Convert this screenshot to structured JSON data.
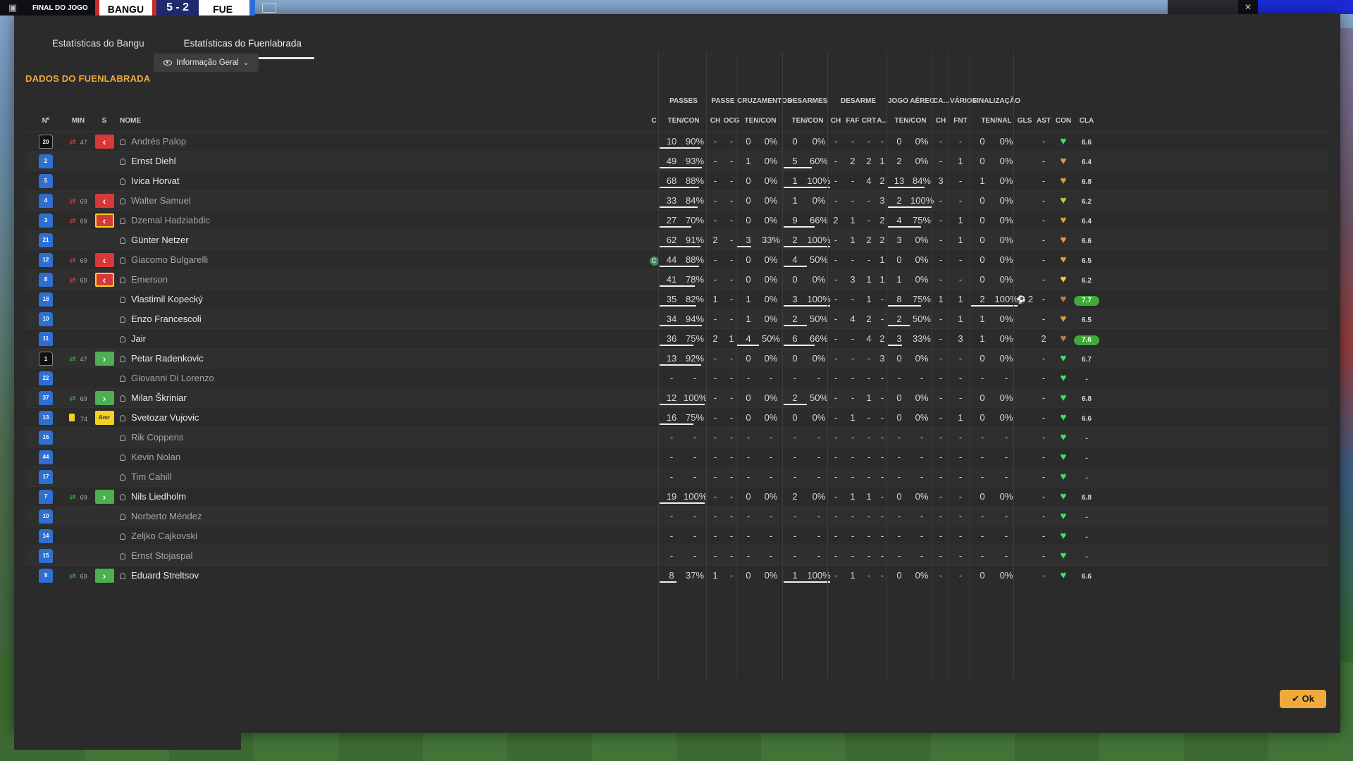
{
  "scorebar": {
    "label": "FINAL DO JOGO",
    "home": "BANGU",
    "score": "5 - 2",
    "away": "FUE"
  },
  "tabs": [
    {
      "label": "Estatísticas do Bangu",
      "active": false
    },
    {
      "label": "Estatísticas do Fuenlabrada",
      "active": true
    }
  ],
  "section_title": "DADOS DO FUENLABRADA",
  "view_select": "Informação Geral",
  "group_headers": [
    "PASSES",
    "PASSE",
    "CRUZAMENTOS",
    "DESARMES",
    "DESARME",
    "JOGO AÉREO",
    "CA...",
    "VÁRIOS",
    "FINALIZAÇÃO"
  ],
  "column_headers": [
    "Nº",
    "MIN",
    "S",
    "NOME",
    "C",
    "TEN/CON",
    "CH",
    "OCG",
    "TEN/CON",
    "TEN/CON",
    "CH",
    "FAF",
    "CRT",
    "A...",
    "TEN/CON",
    "CH",
    "FNT",
    "TEN/NAL",
    "GLS",
    "AST",
    "CON",
    "CLA"
  ],
  "accent": "#f0a93a",
  "players": [
    {
      "num": "20",
      "gk": true,
      "sub": "out",
      "min": "47",
      "evt": "out",
      "name": "Andrés Palop",
      "dim": true,
      "cap": false,
      "p": [
        "10",
        "90%",
        90
      ],
      "ch": "-",
      "ocg": "-",
      "cr": [
        "0",
        "0%",
        0
      ],
      "ds": [
        "0",
        "0%",
        0
      ],
      "d2": [
        "-",
        "-",
        "-",
        "-"
      ],
      "ja": [
        "0",
        "0%",
        0
      ],
      "ca": "-",
      "fnt": "-",
      "fin": [
        "0",
        "0%",
        0
      ],
      "gls": "",
      "ast": "-",
      "con": "green",
      "cla": "6.6",
      "hi": false
    },
    {
      "num": "2",
      "gk": false,
      "sub": "",
      "min": "",
      "evt": "",
      "name": "Ernst Diehl",
      "dim": false,
      "cap": false,
      "p": [
        "49",
        "93%",
        93
      ],
      "ch": "-",
      "ocg": "-",
      "cr": [
        "1",
        "0%",
        0
      ],
      "ds": [
        "5",
        "60%",
        60
      ],
      "d2": [
        "-",
        "2",
        "2",
        "1"
      ],
      "ja": [
        "2",
        "0%",
        0
      ],
      "ca": "-",
      "fnt": "1",
      "fin": [
        "0",
        "0%",
        0
      ],
      "gls": "",
      "ast": "-",
      "con": "orange",
      "cla": "6.4",
      "hi": false
    },
    {
      "num": "5",
      "gk": false,
      "sub": "",
      "min": "",
      "evt": "",
      "name": "Ivica Horvat",
      "dim": false,
      "cap": false,
      "p": [
        "68",
        "88%",
        88
      ],
      "ch": "-",
      "ocg": "-",
      "cr": [
        "0",
        "0%",
        0
      ],
      "ds": [
        "1",
        "100%",
        100
      ],
      "d2": [
        "-",
        "-",
        "4",
        "2"
      ],
      "ja": [
        "13",
        "84%",
        84
      ],
      "ca": "3",
      "fnt": "-",
      "fin": [
        "1",
        "0%",
        0
      ],
      "gls": "",
      "ast": "-",
      "con": "orange",
      "cla": "6.8",
      "hi": false
    },
    {
      "num": "4",
      "gk": false,
      "sub": "out",
      "min": "69",
      "evt": "out",
      "name": "Walter Samuel",
      "dim": true,
      "cap": false,
      "p": [
        "33",
        "84%",
        84
      ],
      "ch": "-",
      "ocg": "-",
      "cr": [
        "0",
        "0%",
        0
      ],
      "ds": [
        "1",
        "0%",
        0
      ],
      "d2": [
        "-",
        "-",
        "-",
        "3"
      ],
      "ja": [
        "2",
        "100%",
        100
      ],
      "ca": "-",
      "fnt": "-",
      "fin": [
        "0",
        "0%",
        0
      ],
      "gls": "",
      "ast": "-",
      "con": "lime",
      "cla": "6.2",
      "hi": false
    },
    {
      "num": "3",
      "gk": false,
      "sub": "out",
      "min": "69",
      "evt": "outyb",
      "name": "Dzemal Hadziabdic",
      "dim": true,
      "cap": false,
      "p": [
        "27",
        "70%",
        70
      ],
      "ch": "-",
      "ocg": "-",
      "cr": [
        "0",
        "0%",
        0
      ],
      "ds": [
        "9",
        "66%",
        66
      ],
      "d2": [
        "2",
        "1",
        "-",
        "2"
      ],
      "ja": [
        "4",
        "75%",
        75
      ],
      "ca": "-",
      "fnt": "1",
      "fin": [
        "0",
        "0%",
        0
      ],
      "gls": "",
      "ast": "-",
      "con": "orange",
      "cla": "6.4",
      "hi": false
    },
    {
      "num": "21",
      "gk": false,
      "sub": "",
      "min": "",
      "evt": "",
      "name": "Günter Netzer",
      "dim": false,
      "cap": false,
      "p": [
        "62",
        "91%",
        91
      ],
      "ch": "2",
      "ocg": "-",
      "cr": [
        "3",
        "33%",
        33
      ],
      "ds": [
        "2",
        "100%",
        100
      ],
      "d2": [
        "-",
        "1",
        "2",
        "2"
      ],
      "ja": [
        "3",
        "0%",
        0
      ],
      "ca": "-",
      "fnt": "1",
      "fin": [
        "0",
        "0%",
        0
      ],
      "gls": "",
      "ast": "-",
      "con": "orange",
      "cla": "6.6",
      "hi": false
    },
    {
      "num": "12",
      "gk": false,
      "sub": "out",
      "min": "69",
      "evt": "out",
      "name": "Giacomo Bulgarelli",
      "dim": true,
      "cap": true,
      "p": [
        "44",
        "88%",
        88
      ],
      "ch": "-",
      "ocg": "-",
      "cr": [
        "0",
        "0%",
        0
      ],
      "ds": [
        "4",
        "50%",
        50
      ],
      "d2": [
        "-",
        "-",
        "-",
        "1"
      ],
      "ja": [
        "0",
        "0%",
        0
      ],
      "ca": "-",
      "fnt": "-",
      "fin": [
        "0",
        "0%",
        0
      ],
      "gls": "",
      "ast": "-",
      "con": "orange",
      "cla": "6.5",
      "hi": false
    },
    {
      "num": "8",
      "gk": false,
      "sub": "out",
      "min": "69",
      "evt": "outyb",
      "name": "Emerson",
      "dim": true,
      "cap": false,
      "p": [
        "41",
        "78%",
        78
      ],
      "ch": "-",
      "ocg": "-",
      "cr": [
        "0",
        "0%",
        0
      ],
      "ds": [
        "0",
        "0%",
        0
      ],
      "d2": [
        "-",
        "3",
        "1",
        "1"
      ],
      "ja": [
        "1",
        "0%",
        0
      ],
      "ca": "-",
      "fnt": "-",
      "fin": [
        "0",
        "0%",
        0
      ],
      "gls": "",
      "ast": "-",
      "con": "yellow",
      "cla": "6.2",
      "hi": false
    },
    {
      "num": "18",
      "gk": false,
      "sub": "",
      "min": "",
      "evt": "",
      "name": "Vlastimil Kopecký",
      "dim": false,
      "cap": false,
      "p": [
        "35",
        "82%",
        82
      ],
      "ch": "1",
      "ocg": "-",
      "cr": [
        "1",
        "0%",
        0
      ],
      "ds": [
        "3",
        "100%",
        100
      ],
      "d2": [
        "-",
        "-",
        "1",
        "-"
      ],
      "ja": [
        "8",
        "75%",
        75
      ],
      "ca": "1",
      "fnt": "1",
      "fin": [
        "2",
        "100%",
        100
      ],
      "gls": "2",
      "ast": "-",
      "con": "brown",
      "cla": "7.7",
      "hi": true
    },
    {
      "num": "10",
      "gk": false,
      "sub": "",
      "min": "",
      "evt": "",
      "name": "Enzo Francescoli",
      "dim": false,
      "cap": false,
      "p": [
        "34",
        "94%",
        94
      ],
      "ch": "-",
      "ocg": "-",
      "cr": [
        "1",
        "0%",
        0
      ],
      "ds": [
        "2",
        "50%",
        50
      ],
      "d2": [
        "-",
        "4",
        "2",
        "-"
      ],
      "ja": [
        "2",
        "50%",
        50
      ],
      "ca": "-",
      "fnt": "1",
      "fin": [
        "1",
        "0%",
        0
      ],
      "gls": "",
      "ast": "-",
      "con": "orange",
      "cla": "6.5",
      "hi": false
    },
    {
      "num": "11",
      "gk": false,
      "sub": "",
      "min": "",
      "evt": "",
      "name": "Jair",
      "dim": false,
      "cap": false,
      "p": [
        "36",
        "75%",
        75
      ],
      "ch": "2",
      "ocg": "1",
      "cr": [
        "4",
        "50%",
        50
      ],
      "ds": [
        "6",
        "66%",
        66
      ],
      "d2": [
        "-",
        "-",
        "4",
        "2"
      ],
      "ja": [
        "3",
        "33%",
        33
      ],
      "ca": "-",
      "fnt": "3",
      "fin": [
        "1",
        "0%",
        0
      ],
      "gls": "",
      "ast": "2",
      "con": "brown",
      "cla": "7.6",
      "hi": true
    },
    {
      "num": "1",
      "gk": true,
      "sub": "in",
      "min": "47",
      "evt": "in",
      "name": "Petar Radenkovic",
      "dim": false,
      "cap": false,
      "p": [
        "13",
        "92%",
        92
      ],
      "ch": "-",
      "ocg": "-",
      "cr": [
        "0",
        "0%",
        0
      ],
      "ds": [
        "0",
        "0%",
        0
      ],
      "d2": [
        "-",
        "-",
        "-",
        "3"
      ],
      "ja": [
        "0",
        "0%",
        0
      ],
      "ca": "-",
      "fnt": "-",
      "fin": [
        "0",
        "0%",
        0
      ],
      "gls": "",
      "ast": "-",
      "con": "green",
      "cla": "6.7",
      "hi": false
    },
    {
      "num": "22",
      "gk": false,
      "sub": "",
      "min": "",
      "evt": "",
      "name": "Giovanni Di Lorenzo",
      "dim": true,
      "cap": false,
      "p": [
        "-",
        "-",
        0
      ],
      "ch": "-",
      "ocg": "-",
      "cr": [
        "-",
        "-",
        0
      ],
      "ds": [
        "-",
        "-",
        0
      ],
      "d2": [
        "-",
        "-",
        "-",
        "-"
      ],
      "ja": [
        "-",
        "-",
        0
      ],
      "ca": "-",
      "fnt": "-",
      "fin": [
        "-",
        "-",
        0
      ],
      "gls": "",
      "ast": "-",
      "con": "green",
      "cla": "-",
      "hi": false
    },
    {
      "num": "37",
      "gk": false,
      "sub": "in",
      "min": "69",
      "evt": "in",
      "name": "Milan Škriniar",
      "dim": false,
      "cap": false,
      "p": [
        "12",
        "100%",
        100
      ],
      "ch": "-",
      "ocg": "-",
      "cr": [
        "0",
        "0%",
        0
      ],
      "ds": [
        "2",
        "50%",
        50
      ],
      "d2": [
        "-",
        "-",
        "1",
        "-"
      ],
      "ja": [
        "0",
        "0%",
        0
      ],
      "ca": "-",
      "fnt": "-",
      "fin": [
        "0",
        "0%",
        0
      ],
      "gls": "",
      "ast": "-",
      "con": "green",
      "cla": "6.8",
      "hi": false
    },
    {
      "num": "13",
      "gk": false,
      "sub": "card",
      "min": "74",
      "evt": "yc",
      "name": "Svetozar Vujovic",
      "dim": false,
      "cap": false,
      "p": [
        "16",
        "75%",
        75
      ],
      "ch": "-",
      "ocg": "-",
      "cr": [
        "0",
        "0%",
        0
      ],
      "ds": [
        "0",
        "0%",
        0
      ],
      "d2": [
        "-",
        "1",
        "-",
        "-"
      ],
      "ja": [
        "0",
        "0%",
        0
      ],
      "ca": "-",
      "fnt": "1",
      "fin": [
        "0",
        "0%",
        0
      ],
      "gls": "",
      "ast": "-",
      "con": "green",
      "cla": "6.6",
      "hi": false
    },
    {
      "num": "16",
      "gk": false,
      "sub": "",
      "min": "",
      "evt": "",
      "name": "Rik Coppens",
      "dim": true,
      "cap": false,
      "p": [
        "-",
        "-",
        0
      ],
      "ch": "-",
      "ocg": "-",
      "cr": [
        "-",
        "-",
        0
      ],
      "ds": [
        "-",
        "-",
        0
      ],
      "d2": [
        "-",
        "-",
        "-",
        "-"
      ],
      "ja": [
        "-",
        "-",
        0
      ],
      "ca": "-",
      "fnt": "-",
      "fin": [
        "-",
        "-",
        0
      ],
      "gls": "",
      "ast": "-",
      "con": "green",
      "cla": "-",
      "hi": false
    },
    {
      "num": "44",
      "gk": false,
      "sub": "",
      "min": "",
      "evt": "",
      "name": "Kevin Nolan",
      "dim": true,
      "cap": false,
      "p": [
        "-",
        "-",
        0
      ],
      "ch": "-",
      "ocg": "-",
      "cr": [
        "-",
        "-",
        0
      ],
      "ds": [
        "-",
        "-",
        0
      ],
      "d2": [
        "-",
        "-",
        "-",
        "-"
      ],
      "ja": [
        "-",
        "-",
        0
      ],
      "ca": "-",
      "fnt": "-",
      "fin": [
        "-",
        "-",
        0
      ],
      "gls": "",
      "ast": "-",
      "con": "green",
      "cla": "-",
      "hi": false
    },
    {
      "num": "17",
      "gk": false,
      "sub": "",
      "min": "",
      "evt": "",
      "name": "Tim Cahill",
      "dim": true,
      "cap": false,
      "p": [
        "-",
        "-",
        0
      ],
      "ch": "-",
      "ocg": "-",
      "cr": [
        "-",
        "-",
        0
      ],
      "ds": [
        "-",
        "-",
        0
      ],
      "d2": [
        "-",
        "-",
        "-",
        "-"
      ],
      "ja": [
        "-",
        "-",
        0
      ],
      "ca": "-",
      "fnt": "-",
      "fin": [
        "-",
        "-",
        0
      ],
      "gls": "",
      "ast": "-",
      "con": "green",
      "cla": "-",
      "hi": false
    },
    {
      "num": "7",
      "gk": false,
      "sub": "in",
      "min": "69",
      "evt": "in",
      "name": "Nils Liedholm",
      "dim": false,
      "cap": false,
      "p": [
        "19",
        "100%",
        100
      ],
      "ch": "-",
      "ocg": "-",
      "cr": [
        "0",
        "0%",
        0
      ],
      "ds": [
        "2",
        "0%",
        0
      ],
      "d2": [
        "-",
        "1",
        "1",
        "-"
      ],
      "ja": [
        "0",
        "0%",
        0
      ],
      "ca": "-",
      "fnt": "-",
      "fin": [
        "0",
        "0%",
        0
      ],
      "gls": "",
      "ast": "-",
      "con": "green",
      "cla": "6.8",
      "hi": false
    },
    {
      "num": "10",
      "gk": false,
      "sub": "",
      "min": "",
      "evt": "",
      "name": "Norberto Méndez",
      "dim": true,
      "cap": false,
      "p": [
        "-",
        "-",
        0
      ],
      "ch": "-",
      "ocg": "-",
      "cr": [
        "-",
        "-",
        0
      ],
      "ds": [
        "-",
        "-",
        0
      ],
      "d2": [
        "-",
        "-",
        "-",
        "-"
      ],
      "ja": [
        "-",
        "-",
        0
      ],
      "ca": "-",
      "fnt": "-",
      "fin": [
        "-",
        "-",
        0
      ],
      "gls": "",
      "ast": "-",
      "con": "green",
      "cla": "-",
      "hi": false
    },
    {
      "num": "14",
      "gk": false,
      "sub": "",
      "min": "",
      "evt": "",
      "name": "Zeljko Cajkovski",
      "dim": true,
      "cap": false,
      "p": [
        "-",
        "-",
        0
      ],
      "ch": "-",
      "ocg": "-",
      "cr": [
        "-",
        "-",
        0
      ],
      "ds": [
        "-",
        "-",
        0
      ],
      "d2": [
        "-",
        "-",
        "-",
        "-"
      ],
      "ja": [
        "-",
        "-",
        0
      ],
      "ca": "-",
      "fnt": "-",
      "fin": [
        "-",
        "-",
        0
      ],
      "gls": "",
      "ast": "-",
      "con": "green",
      "cla": "-",
      "hi": false
    },
    {
      "num": "15",
      "gk": false,
      "sub": "",
      "min": "",
      "evt": "",
      "name": "Ernst Stojaspal",
      "dim": true,
      "cap": false,
      "p": [
        "-",
        "-",
        0
      ],
      "ch": "-",
      "ocg": "-",
      "cr": [
        "-",
        "-",
        0
      ],
      "ds": [
        "-",
        "-",
        0
      ],
      "d2": [
        "-",
        "-",
        "-",
        "-"
      ],
      "ja": [
        "-",
        "-",
        0
      ],
      "ca": "-",
      "fnt": "-",
      "fin": [
        "-",
        "-",
        0
      ],
      "gls": "",
      "ast": "-",
      "con": "green",
      "cla": "-",
      "hi": false
    },
    {
      "num": "9",
      "gk": false,
      "sub": "in",
      "min": "69",
      "evt": "in",
      "name": "Eduard Streltsov",
      "dim": false,
      "cap": false,
      "p": [
        "8",
        "37%",
        37
      ],
      "ch": "1",
      "ocg": "-",
      "cr": [
        "0",
        "0%",
        0
      ],
      "ds": [
        "1",
        "100%",
        100
      ],
      "d2": [
        "-",
        "1",
        "-",
        "-"
      ],
      "ja": [
        "0",
        "0%",
        0
      ],
      "ca": "-",
      "fnt": "-",
      "fin": [
        "0",
        "0%",
        0
      ],
      "gls": "",
      "ast": "-",
      "con": "green",
      "cla": "6.6",
      "hi": false
    }
  ],
  "evt_labels": {
    "yc": "Amr"
  },
  "heart_colors": {
    "green": "#3ee06a",
    "lime": "#9fd84a",
    "yellow": "#f0d030",
    "orange": "#e89a3a",
    "brown": "#b88050"
  },
  "ok_label": "Ok"
}
